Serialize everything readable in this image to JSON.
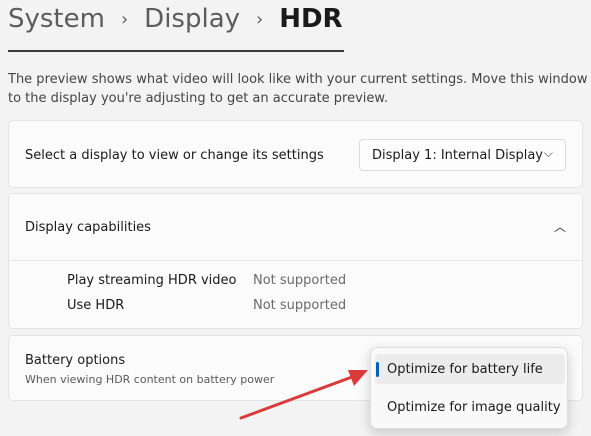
{
  "breadcrumb": {
    "item1": "System",
    "sep1": "›",
    "item2": "Display",
    "sep2": "›",
    "current": "HDR"
  },
  "description": "The preview shows what video will look like with your current settings. Move this window to the display you're adjusting to get an accurate preview.",
  "select_display": {
    "label": "Select a display to view or change its settings",
    "value": "Display 1: Internal Display",
    "chevron": "⌵"
  },
  "capabilities": {
    "label": "Display capabilities",
    "toggle": "︿",
    "items": [
      {
        "name": "Play streaming HDR video",
        "value": "Not supported"
      },
      {
        "name": "Use HDR",
        "value": "Not supported"
      }
    ]
  },
  "battery": {
    "label": "Battery options",
    "sublabel": "When viewing HDR content on battery power",
    "options": [
      "Optimize for battery life",
      "Optimize for image quality"
    ]
  },
  "colors": {
    "accent": "#005fb8",
    "annotation_arrow": "#d93a3a"
  }
}
